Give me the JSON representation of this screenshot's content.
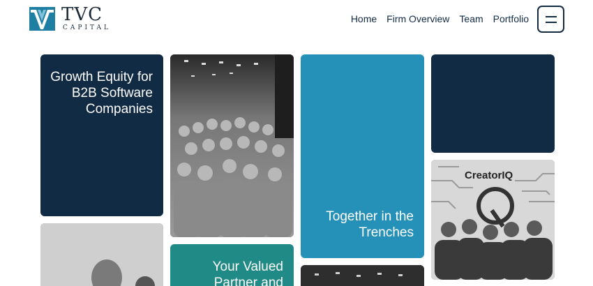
{
  "brand": {
    "name": "TVC",
    "sub": "CAPITAL",
    "logo_color": "#1f7fa2"
  },
  "nav": {
    "items": [
      {
        "label": "Home"
      },
      {
        "label": "Firm Overview"
      },
      {
        "label": "Team"
      },
      {
        "label": "Portfolio"
      }
    ],
    "menu_icon": "hamburger-menu-icon"
  },
  "tiles": {
    "growth": {
      "text": "Growth Equity for B2B Software Companies",
      "color": "#122b44"
    },
    "trenches": {
      "text": "Together in the Trenches",
      "color": "#2691b8"
    },
    "partner": {
      "text": "Your Valued Partner and",
      "color": "#1f8a86"
    },
    "creatoriq": {
      "sign_text": "CreatorIQ"
    }
  }
}
